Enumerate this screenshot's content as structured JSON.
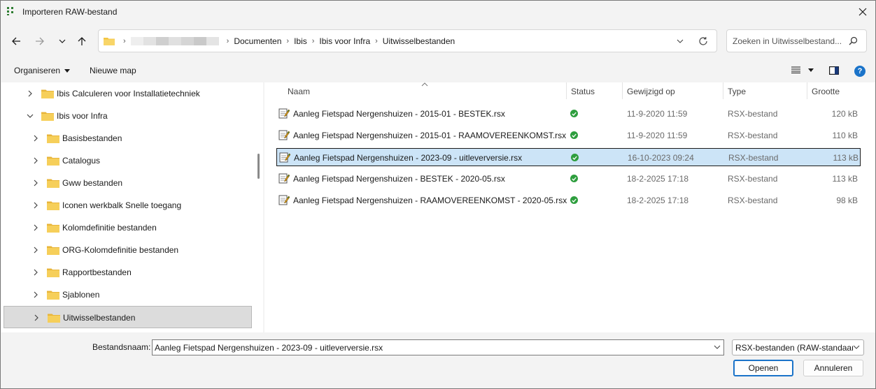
{
  "window": {
    "title": "Importeren RAW-bestand"
  },
  "address": {
    "breadcrumbs": [
      "Documenten",
      "Ibis",
      "Ibis voor Infra",
      "Uitwisselbestanden"
    ]
  },
  "search": {
    "placeholder": "Zoeken in Uitwisselbestand..."
  },
  "toolbar": {
    "organize_label": "Organiseren",
    "new_folder_label": "Nieuwe map",
    "help_label": "?"
  },
  "nav_tree": {
    "items": [
      {
        "label": "Ibis Calculeren voor Installatietechniek",
        "level": 0,
        "expanded": false,
        "selected": false
      },
      {
        "label": "Ibis voor Infra",
        "level": 0,
        "expanded": true,
        "selected": false
      },
      {
        "label": "Basisbestanden",
        "level": 1,
        "expanded": false,
        "selected": false
      },
      {
        "label": "Catalogus",
        "level": 1,
        "expanded": false,
        "selected": false
      },
      {
        "label": "Gww bestanden",
        "level": 1,
        "expanded": false,
        "selected": false
      },
      {
        "label": "Iconen werkbalk Snelle toegang",
        "level": 1,
        "expanded": false,
        "selected": false
      },
      {
        "label": "Kolomdefinitie bestanden",
        "level": 1,
        "expanded": false,
        "selected": false
      },
      {
        "label": "ORG-Kolomdefinitie bestanden",
        "level": 1,
        "expanded": false,
        "selected": false
      },
      {
        "label": "Rapportbestanden",
        "level": 1,
        "expanded": false,
        "selected": false
      },
      {
        "label": "Sjablonen",
        "level": 1,
        "expanded": false,
        "selected": false
      },
      {
        "label": "Uitwisselbestanden",
        "level": 1,
        "expanded": false,
        "selected": true
      }
    ]
  },
  "file_list": {
    "columns": {
      "name": "Naam",
      "status": "Status",
      "modified": "Gewijzigd op",
      "type": "Type",
      "size": "Grootte"
    },
    "rows": [
      {
        "name": "Aanleg Fietspad Nergenshuizen - 2015-01 - BESTEK.rsx",
        "modified": "11-9-2020 11:59",
        "type": "RSX-bestand",
        "size": "120 kB",
        "selected": false
      },
      {
        "name": "Aanleg Fietspad Nergenshuizen - 2015-01 - RAAMOVEREENKOMST.rsx",
        "modified": "11-9-2020 11:59",
        "type": "RSX-bestand",
        "size": "110 kB",
        "selected": false
      },
      {
        "name": "Aanleg Fietspad Nergenshuizen - 2023-09 - uitleverversie.rsx",
        "modified": "16-10-2023 09:24",
        "type": "RSX-bestand",
        "size": "113 kB",
        "selected": true
      },
      {
        "name": "Aanleg Fietspad Nergenshuizen - BESTEK - 2020-05.rsx",
        "modified": "18-2-2025 17:18",
        "type": "RSX-bestand",
        "size": "113 kB",
        "selected": false
      },
      {
        "name": "Aanleg Fietspad Nergenshuizen - RAAMOVEREENKOMST - 2020-05.rsx",
        "modified": "18-2-2025 17:18",
        "type": "RSX-bestand",
        "size": "98 kB",
        "selected": false
      }
    ]
  },
  "bottom": {
    "filename_label": "Bestandsnaam:",
    "filename_value": "Aanleg Fietspad Nergenshuizen - 2023-09 - uitleverversie.rsx",
    "filter_value": "RSX-bestanden (RAW-standaard)",
    "open_label": "Openen",
    "cancel_label": "Annuleren"
  },
  "colors": {
    "accent": "#1a73c9",
    "selection": "#cce4f7",
    "folder": "#f4c542",
    "status_ok": "#2e9e3e"
  }
}
